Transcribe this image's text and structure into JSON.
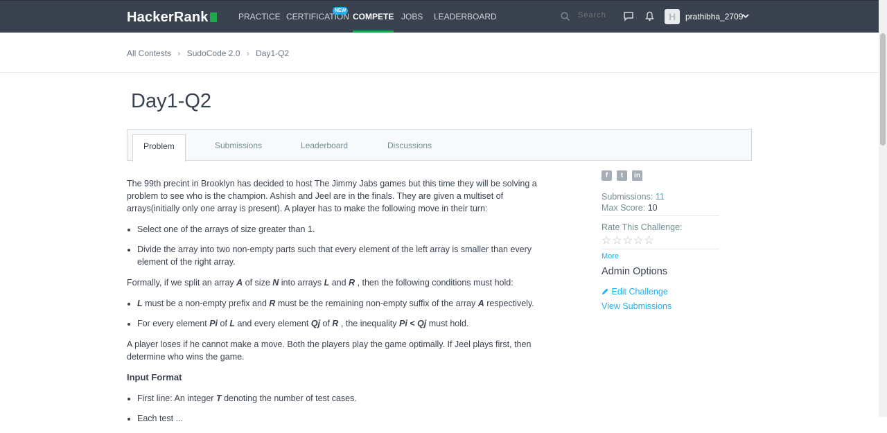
{
  "header": {
    "logo": "HackerRank",
    "nav": [
      {
        "label": "PRACTICE"
      },
      {
        "label": "CERTIFICATION"
      },
      {
        "label": "COMPETE"
      },
      {
        "label": "JOBS"
      },
      {
        "label": "LEADERBOARD"
      }
    ],
    "new_badge": "NEW",
    "search_placeholder": "Search",
    "avatar_letter": "H",
    "username": "prathibha_2709"
  },
  "breadcrumb": [
    "All Contests",
    "SudoCode 2.0",
    "Day1-Q2"
  ],
  "page_title": "Day1-Q2",
  "tabs": [
    {
      "label": "Problem"
    },
    {
      "label": "Submissions"
    },
    {
      "label": "Leaderboard"
    },
    {
      "label": "Discussions"
    }
  ],
  "problem": {
    "intro": "The 99th precint in Brooklyn has decided to host The Jimmy Jabs games but this time they will be solving a problem to see who is the champion. Ashish and Jeel are in the finals. They are given a multiset of arrays(initially only one array is present). A player has to make the following move in their turn:",
    "moves": [
      "Select one of the arrays of size greater than 1.",
      "Divide the array into two non-empty parts such that every element of the left array is smaller than every element of the right array."
    ],
    "formally": {
      "p1": "Formally, if we split an array ",
      "v1": "A",
      "p2": " of size ",
      "v2": "N",
      "p3": " into arrays ",
      "v3": "L",
      "p4": " and ",
      "v4": "R",
      "p5": " , then the following conditions must hold:"
    },
    "cond1": {
      "v1": "L",
      "p1": " must be a non-empty prefix and ",
      "v2": "R",
      "p2": " must be the remaining non-empty suffix of the array ",
      "v3": "A",
      "p3": " respectively."
    },
    "cond2": {
      "p1": "For every element ",
      "v1": "Pi",
      "p2": " of ",
      "v2": "L",
      "p3": " and every element ",
      "v3": "Qj",
      "p4": " of ",
      "v4": "R",
      "p5": " , the inequality ",
      "v5": "Pi < Qj",
      "p6": " must hold."
    },
    "loses": "A player loses if he cannot make a move. Both the players play the game optimally. If Jeel plays first, then determine who wins the game.",
    "input_format_title": "Input Format",
    "input1": {
      "p1": "First line: An integer ",
      "v1": "T",
      "p2": " denoting the number of test cases."
    },
    "input2_partial": "Each test ..."
  },
  "sidebar": {
    "submissions_label": "Submissions: ",
    "submissions_value": "11",
    "max_score_label": "Max Score: ",
    "max_score_value": "10",
    "rate_label": "Rate This Challenge:",
    "stars": [
      "☆",
      "☆",
      "☆",
      "☆",
      "☆"
    ],
    "more": "More",
    "admin_title": "Admin Options",
    "edit_challenge": "Edit Challenge",
    "view_submissions": "View Submissions"
  },
  "colors": {
    "header_bg": "#39424e",
    "accent_green": "#1ba94c",
    "link_blue": "#1cb0f6"
  }
}
